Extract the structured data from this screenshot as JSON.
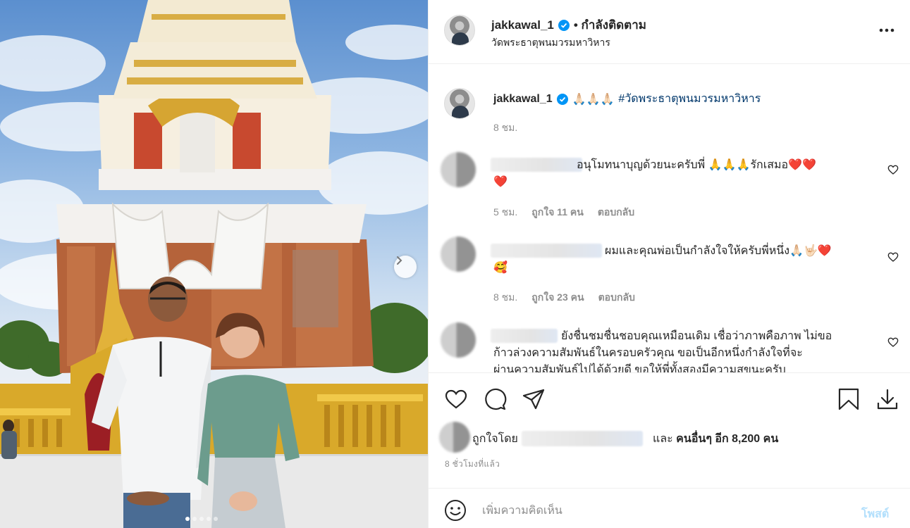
{
  "post": {
    "username": "jakkawal_1",
    "follow_status": "• กำลังติดตาม",
    "location": "วัดพระธาตุพนมวรมหาวิหาร",
    "more_icon": "more-horizontal-icon"
  },
  "caption": {
    "username": "jakkawal_1",
    "emojis": "🙏🏻🙏🏻🙏🏻",
    "hashtag": "#วัดพระธาตุพนมวรมหาวิหาร",
    "time": "8 ชม."
  },
  "comments": [
    {
      "text": "อนุโมทนาบุญด้วยนะครับพี่ 🙏🙏🙏รักเสมอ❤️❤️",
      "text_line2": "❤️",
      "time": "5 ชม.",
      "likes": "ถูกใจ 11 คน",
      "reply": "ตอบกลับ"
    },
    {
      "text": "ผมและคุณพ่อเป็นกำลังใจให้ครับพี่หนึ่ง🙏🏻🤟🏻❤️",
      "text_line2": "🥰",
      "time": "8 ชม.",
      "likes": "ถูกใจ 23 คน",
      "reply": "ตอบกลับ"
    },
    {
      "text": "ยังชื่นชมชื่นชอบคุณเหมือนเดิม เชื่อว่าภาพคือภาพ ไม่ขอ",
      "text_line2": "ก้าวล่วงความสัมพันธ์ในครอบครัวคุณ ขอเป็นอีกหนึ่งกำลังใจที่จะ",
      "text_line3": "ผ่านความสัมพันธ์ไปได้ด้วยดี ขอให้พี่ทั้งสองมีความสุขนะครับ"
    }
  ],
  "likes": {
    "prefix": "ถูกใจโดย",
    "and": "และ",
    "others": "คนอื่นๆ อีก 8,200 คน",
    "ago": "8 ชั่วโมงที่แล้ว"
  },
  "add_comment": {
    "placeholder": "เพิ่มความคิดเห็น",
    "post_label": "โพสต์"
  },
  "carousel": {
    "total": 5,
    "active_index": 0
  },
  "colors": {
    "verified": "#0095f6",
    "link": "#00376b",
    "muted": "#8e8e8e",
    "post_disabled": "#b2dffc"
  }
}
